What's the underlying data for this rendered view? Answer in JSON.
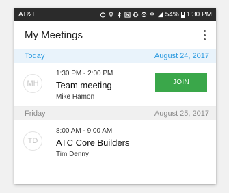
{
  "status_bar": {
    "carrier": "AT&T",
    "battery": "54%",
    "time": "1:30 PM"
  },
  "app_bar": {
    "title": "My Meetings"
  },
  "sections": [
    {
      "label": "Today",
      "date": "August 24, 2017",
      "meetings": [
        {
          "initials": "MH",
          "time": "1:30 PM - 2:00 PM",
          "title": "Team meeting",
          "organizer": "Mike Hamon",
          "join_label": "JOIN"
        }
      ]
    },
    {
      "label": "Friday",
      "date": "August 25, 2017",
      "meetings": [
        {
          "initials": "TD",
          "time": "8:00 AM - 9:00 AM",
          "title": "ATC Core Builders",
          "organizer": "Tim Denny"
        }
      ]
    }
  ],
  "colors": {
    "status_bar_bg": "#2b2b2b",
    "today_header_bg": "#e9f3fb",
    "today_header_text": "#2d9be0",
    "join_button": "#3aa74a"
  }
}
